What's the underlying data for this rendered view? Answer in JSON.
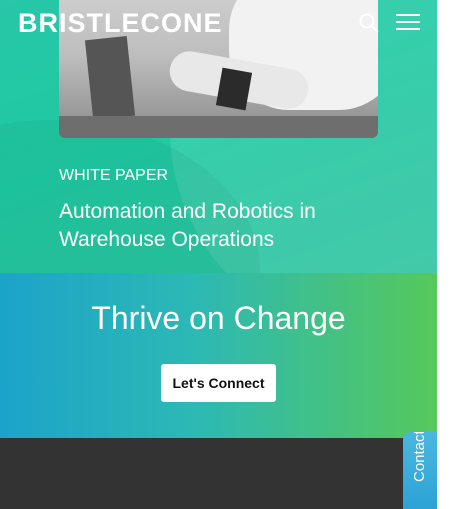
{
  "header": {
    "logo_text": "BRISTLECONE",
    "search_icon": "search-icon",
    "menu_icon": "hamburger-menu-icon"
  },
  "hero": {
    "eyebrow": "WHITE PAPER",
    "title": "Automation and Robotics in Warehouse Operations"
  },
  "cta": {
    "title": "Thrive on Change",
    "button_label": "Let's Connect"
  },
  "contact_tab": {
    "label": "Contact Us"
  },
  "colors": {
    "hero_green": "#1fc9a2",
    "cta_blue": "#1ca3c9",
    "cta_green": "#56c85b",
    "footer": "#333333",
    "tab_blue": "#2aa2d4"
  }
}
